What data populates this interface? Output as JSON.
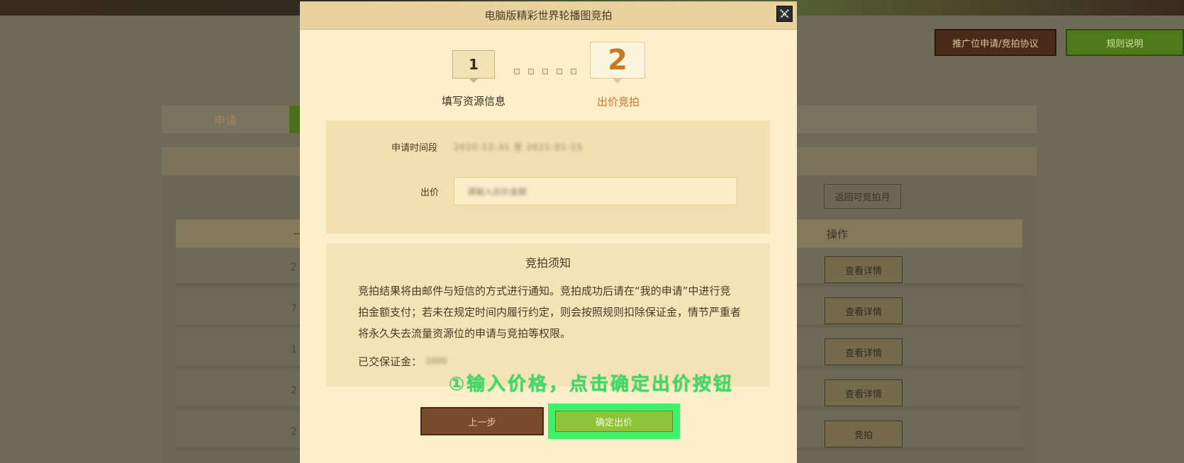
{
  "background": {
    "buttons": {
      "agreement": "推广位申请/竞拍协议",
      "rules": "规则说明"
    },
    "tab_apply": "申请",
    "return_button": "返回可竞拍月",
    "table": {
      "header_dash": "—",
      "header_ops": "操作",
      "rows": [
        {
          "num": "2",
          "op": "查看详情"
        },
        {
          "num": "7",
          "op": "查看详情"
        },
        {
          "num": "1",
          "op": "查看详情"
        },
        {
          "num": "2",
          "op": "查看详情"
        },
        {
          "num": "2",
          "op": "竞拍"
        }
      ]
    }
  },
  "modal": {
    "title": "电脑版精彩世界轮播图竞拍",
    "steps": [
      {
        "number": "1",
        "label": "填写资源信息"
      },
      {
        "number": "2",
        "label": "出价竞拍"
      }
    ],
    "form": {
      "period_label": "申请时间段",
      "period_value": "2020-12-31 至 2021-01-15",
      "price_label": "出价",
      "price_value": "请输入出价金额"
    },
    "notice": {
      "title": "竞拍须知",
      "body": "竞拍结果将由邮件与短信的方式进行通知。竞拍成功后请在“我的申请”中进行竞拍金额支付；若未在规定时间内履行约定，则会按照规则扣除保证金，情节严重者将永久失去流量资源位的申请与竞拍等权限。",
      "deposit_label": "已交保证金：",
      "deposit_value": "1000"
    },
    "annotation": "①输入价格，点击确定出价按钮",
    "buttons": {
      "prev": "上一步",
      "confirm": "确定出价"
    }
  }
}
